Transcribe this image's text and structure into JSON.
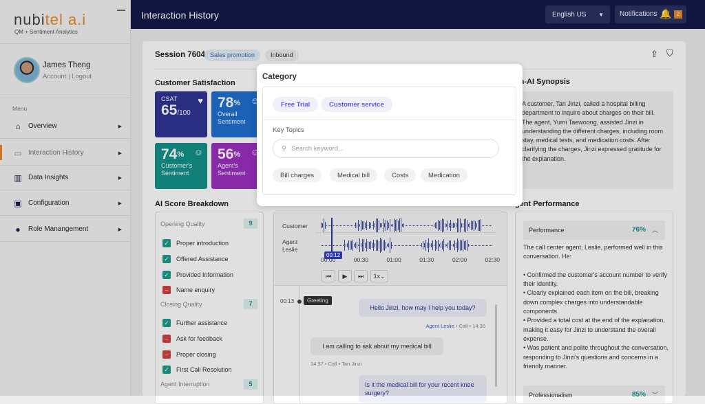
{
  "brand": {
    "logo_main": "nubi",
    "logo_accent": "tel a.i",
    "tagline": "QM + Sentiment Analytics"
  },
  "user": {
    "name": "James Theng",
    "links": "Account | Logout"
  },
  "sidebar": {
    "menu_label": "Menu",
    "items": [
      {
        "label": "Overview",
        "icon": "home-icon",
        "active": false
      },
      {
        "label": "Interaction History",
        "icon": "chat-icon",
        "active": true
      },
      {
        "label": "Data Insights",
        "icon": "chart-icon",
        "active": false
      },
      {
        "label": "Configuration",
        "icon": "monitor-icon",
        "active": false
      },
      {
        "label": "Role Manangement",
        "icon": "user-icon",
        "active": false
      }
    ]
  },
  "header": {
    "title": "Interaction History",
    "language": "English US",
    "notifications_label": "Notifications",
    "notifications_count": "2"
  },
  "session": {
    "title": "Session 7604",
    "tags": [
      "Sales promotion",
      "Inbound"
    ]
  },
  "satisfaction": {
    "heading": "Customer Satisfaction",
    "tiles": [
      {
        "label": "CSAT",
        "value": "65",
        "suffix": "/100",
        "color": "#2f3596"
      },
      {
        "value": "78",
        "suffix": "%",
        "label": "Overall Sentiment",
        "color": "#1f6fd0"
      },
      {
        "value": "74",
        "suffix": "%",
        "label": "Customer's Sentiment",
        "color": "#14928a"
      },
      {
        "value": "56",
        "suffix": "%",
        "label": "Agent's Sentiment",
        "color": "#9b2fc0"
      }
    ]
  },
  "ai_score": {
    "heading": "AI Score Breakdown",
    "sections": [
      {
        "title": "Opening Quality",
        "count": "9",
        "items": [
          {
            "label": "Proper introduction",
            "ok": true
          },
          {
            "label": "Offered Assistance",
            "ok": true
          },
          {
            "label": "Provided Information",
            "ok": true
          },
          {
            "label": "Name enquiry",
            "ok": false
          }
        ]
      },
      {
        "title": "Closing Quality",
        "count": "7",
        "items": [
          {
            "label": "Further assistance",
            "ok": true
          },
          {
            "label": "Ask for feedback",
            "ok": false
          },
          {
            "label": "Proper closing",
            "ok": false
          },
          {
            "label": "First Call Resolution",
            "ok": true
          }
        ]
      },
      {
        "title": "Agent Interruption",
        "count": "5",
        "items": []
      }
    ]
  },
  "audio": {
    "tracks": [
      "Customer",
      "Agent Leslie"
    ],
    "current_time": "00:12",
    "ticks": [
      "00:00",
      "00:30",
      "01:00",
      "01:30",
      "02:00",
      "02:30"
    ],
    "speed": "1x"
  },
  "transcript": {
    "marker_time": "00:13",
    "marker_label": "Greeting",
    "messages": [
      {
        "text": "Hello Jinzi, how may I help you today?",
        "speaker": "Agent Leslie",
        "meta": " • Call • 14:36",
        "side": "agent"
      },
      {
        "text": "I am calling to ask about my medical bill",
        "meta": "14:37 • Call • Tan Jinzi",
        "side": "customer"
      },
      {
        "text": "Is it the medical bill for your recent knee surgery?",
        "side": "agent"
      }
    ]
  },
  "synopsis": {
    "heading": "Gen-AI Synopsis",
    "text": "A customer, Tan Jinzi, called a hospital billing department to inquire about charges on their bill. The agent, Yumi Taewoong, assisted Jinzi in understanding the different charges, including room stay, medical tests, and medication costs. After clarifying the charges, Jinzi expressed gratitude for the explanation."
  },
  "agent_performance": {
    "heading": "Agent Performance",
    "items": [
      {
        "label": "Performance",
        "pct": "76%",
        "expanded": true,
        "intro": "The call center agent, Leslie, performed well in this conversation. He:",
        "bullets": [
          "• Confirmed the customer's account number to verify their identity.",
          "• Clearly explained each item on the bill, breaking down complex charges into understandable components.",
          "• Provided a total cost at the end of the explanation, making it easy for Jinzi to understand the overall expense.",
          "• Was patient and polite throughout the conversation, responding to Jinzi's questions and concerns in a friendly manner."
        ]
      },
      {
        "label": "Professionalism",
        "pct": "85%",
        "expanded": false
      }
    ]
  },
  "popup": {
    "title": "Category",
    "categories": [
      "Free Trial",
      "Customer service"
    ],
    "key_topics_label": "Key Topics",
    "search_placeholder": "Search keyword...",
    "topics": [
      "Bill charges",
      "Medical bill",
      "Costs",
      "Medication"
    ]
  }
}
